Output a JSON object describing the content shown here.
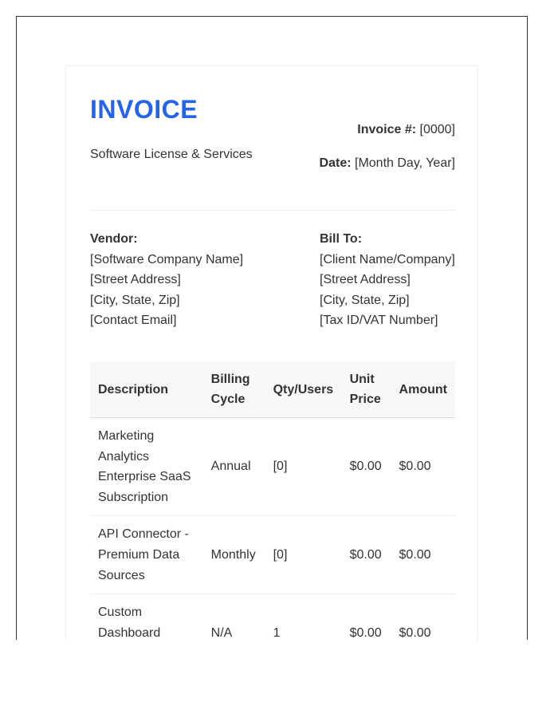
{
  "invoice": {
    "title": "INVOICE",
    "subtitle": "Software License & Services",
    "number_label": "Invoice #:",
    "number_value": "[0000]",
    "date_label": "Date:",
    "date_value": "[Month Day, Year]",
    "accent_color": "#2563eb"
  },
  "vendor": {
    "heading": "Vendor:",
    "lines": [
      "[Software Company Name]",
      "[Street Address]",
      "[City, State, Zip]",
      "[Contact Email]"
    ]
  },
  "bill_to": {
    "heading": "Bill To:",
    "lines": [
      "[Client Name/Company]",
      "[Street Address]",
      "[City, State, Zip]",
      "[Tax ID/VAT Number]"
    ]
  },
  "table": {
    "headers": [
      "Description",
      "Billing Cycle",
      "Qty/Users",
      "Unit Price",
      "Amount"
    ],
    "rows": [
      [
        "Marketing Analytics Enterprise SaaS Subscription",
        "Annual",
        "[0]",
        "$0.00",
        "$0.00"
      ],
      [
        "API Connector - Premium Data Sources",
        "Monthly",
        "[0]",
        "$0.00",
        "$0.00"
      ],
      [
        "Custom Dashboard Implementation",
        "N/A",
        "1",
        "$0.00",
        "$0.00"
      ]
    ]
  }
}
